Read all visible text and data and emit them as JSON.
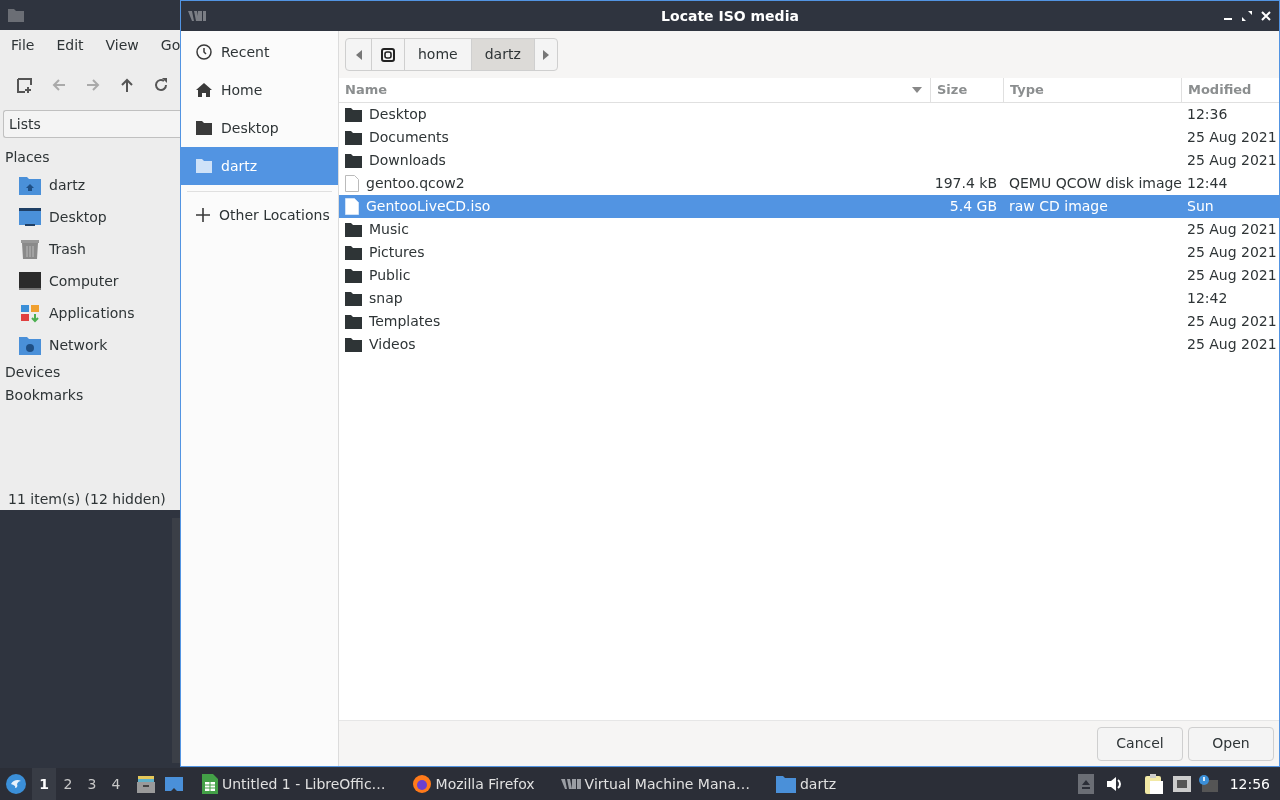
{
  "back_window": {
    "menu": [
      "File",
      "Edit",
      "View",
      "Go"
    ],
    "location_field": "Lists",
    "sections": [
      {
        "title": "Places",
        "items": [
          {
            "label": "dartz",
            "kind": "home"
          },
          {
            "label": "Desktop",
            "kind": "desktop"
          },
          {
            "label": "Trash",
            "kind": "trash"
          },
          {
            "label": "Computer",
            "kind": "computer"
          },
          {
            "label": "Applications",
            "kind": "applications"
          },
          {
            "label": "Network",
            "kind": "network"
          }
        ]
      },
      {
        "title": "Devices"
      },
      {
        "title": "Bookmarks"
      }
    ],
    "status": "11 item(s) (12 hidden)"
  },
  "dialog": {
    "title": "Locate ISO media",
    "sidebar": [
      {
        "label": "Recent",
        "kind": "recent",
        "selected": false
      },
      {
        "label": "Home",
        "kind": "home",
        "selected": false
      },
      {
        "label": "Desktop",
        "kind": "folder",
        "selected": false
      },
      {
        "label": "dartz",
        "kind": "folder",
        "selected": true
      }
    ],
    "other_locations": "Other Locations",
    "path": [
      {
        "label": "home",
        "selected": false
      },
      {
        "label": "dartz",
        "selected": true
      }
    ],
    "columns": [
      "Name",
      "Size",
      "Type",
      "Modified"
    ],
    "rows": [
      {
        "name": "Desktop",
        "kind": "folder",
        "modified": "12:36",
        "selected": false
      },
      {
        "name": "Documents",
        "kind": "folder",
        "modified": "25 Aug 2021",
        "selected": false
      },
      {
        "name": "Downloads",
        "kind": "folder",
        "modified": "25 Aug 2021",
        "selected": false
      },
      {
        "name": "gentoo.qcow2",
        "kind": "file",
        "size": "197.4 kB",
        "type": "QEMU QCOW disk image",
        "modified": "12:44",
        "selected": false
      },
      {
        "name": "GentooLiveCD.iso",
        "kind": "file",
        "size": "5.4 GB",
        "type": "raw CD image",
        "modified": "Sun",
        "selected": true
      },
      {
        "name": "Music",
        "kind": "folder",
        "modified": "25 Aug 2021",
        "selected": false
      },
      {
        "name": "Pictures",
        "kind": "folder",
        "modified": "25 Aug 2021",
        "selected": false
      },
      {
        "name": "Public",
        "kind": "folder",
        "modified": "25 Aug 2021",
        "selected": false
      },
      {
        "name": "snap",
        "kind": "folder",
        "modified": "12:42",
        "selected": false
      },
      {
        "name": "Templates",
        "kind": "folder",
        "modified": "25 Aug 2021",
        "selected": false
      },
      {
        "name": "Videos",
        "kind": "folder",
        "modified": "25 Aug 2021",
        "selected": false
      }
    ],
    "buttons": [
      "Cancel",
      "Open"
    ]
  },
  "taskbar": {
    "workspaces": [
      {
        "label": "1",
        "selected": true
      },
      {
        "label": "2",
        "selected": false
      },
      {
        "label": "3",
        "selected": false
      },
      {
        "label": "4",
        "selected": false
      }
    ],
    "tasks": [
      {
        "label": "Untitled 1 - LibreOffic…",
        "kind": "spreadsheet"
      },
      {
        "label": "Mozilla Firefox",
        "kind": "browser"
      },
      {
        "label": "Virtual Machine Mana…",
        "kind": "vm"
      },
      {
        "label": "dartz",
        "kind": "folder"
      }
    ],
    "clock": "12:56"
  }
}
